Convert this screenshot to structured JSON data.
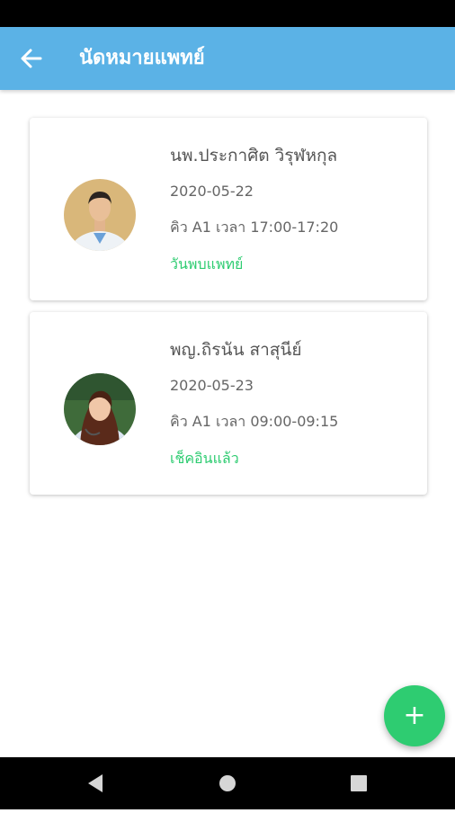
{
  "app_bar": {
    "title": "นัดหมายแพทย์",
    "color": "#5bb2e6",
    "back_icon": "arrow-left-icon"
  },
  "appointments": [
    {
      "doctor_name": "นพ.ประกาศิต วิรุฬหกุล",
      "date": "2020-05-22",
      "slot": "คิว A1 เวลา 17:00-17:20",
      "status": "วันพบแพทย์",
      "status_color": "#2ecc71"
    },
    {
      "doctor_name": "พญ.ถิรนัน สาสุนีย์",
      "date": "2020-05-23",
      "slot": "คิว A1 เวลา 09:00-09:15",
      "status": "เช็คอินแล้ว",
      "status_color": "#2ecc71"
    }
  ],
  "fab": {
    "icon": "plus-icon",
    "symbol": "+",
    "color": "#2ecc71"
  },
  "nav": {
    "back_icon": "triangle-back-icon",
    "home_icon": "circle-home-icon",
    "recents_icon": "square-recents-icon"
  }
}
